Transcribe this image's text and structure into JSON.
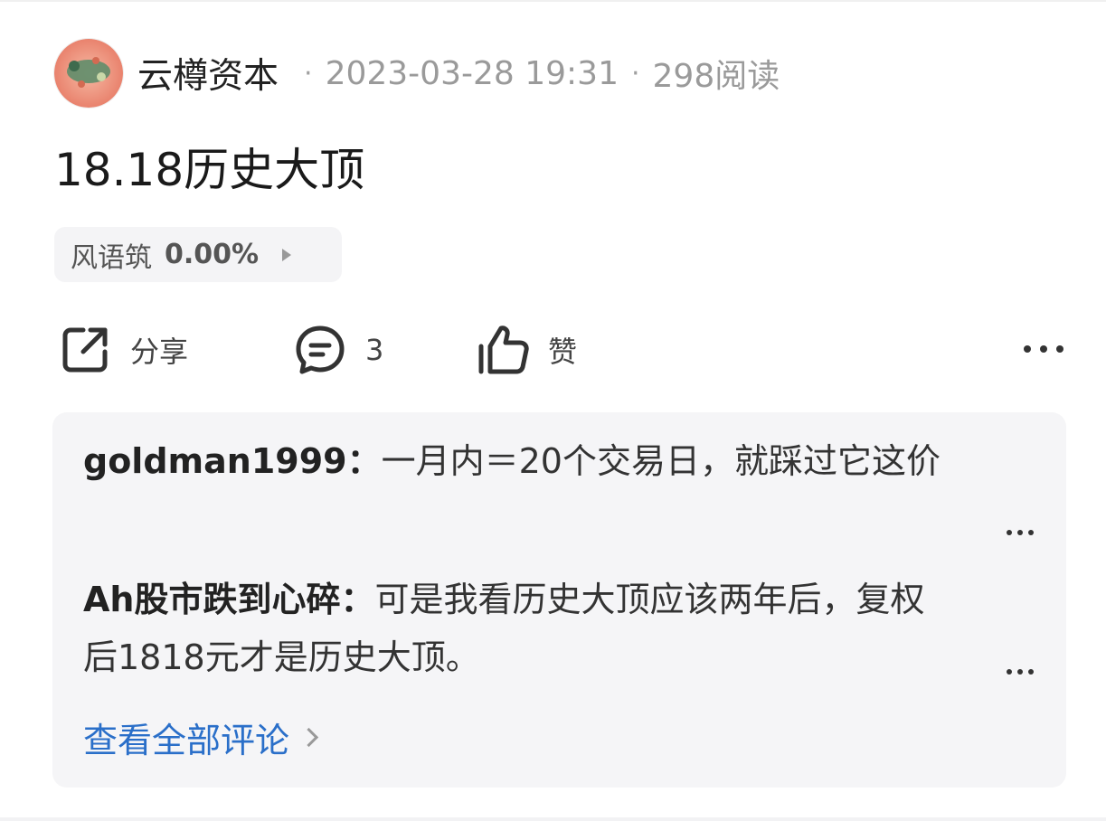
{
  "post": {
    "author": "云樽资本",
    "datetime": "2023-03-28 19:31",
    "reads": "298阅读",
    "separator": "·",
    "title": "18.18历史大顶"
  },
  "stock": {
    "name": "风语筑",
    "change": "0.00%"
  },
  "actions": {
    "share_label": "分享",
    "comment_count": "3",
    "like_label": "赞"
  },
  "comments": [
    {
      "author": "goldman1999：",
      "text": "一月内＝20个交易日，就踩过它这价"
    },
    {
      "author": "Ah股市跌到心碎：",
      "text": "可是我看历史大顶应该两年后，复权后1818元才是历史大顶。"
    }
  ],
  "view_all_label": "查看全部评论",
  "colors": {
    "link": "#2a6fc9",
    "muted": "#9a9a9a",
    "card_bg": "#f5f5f7"
  },
  "icons": {
    "share": "share-icon",
    "comment": "comment-bubble-icon",
    "like": "thumbs-up-icon",
    "more": "more-dots-icon"
  }
}
